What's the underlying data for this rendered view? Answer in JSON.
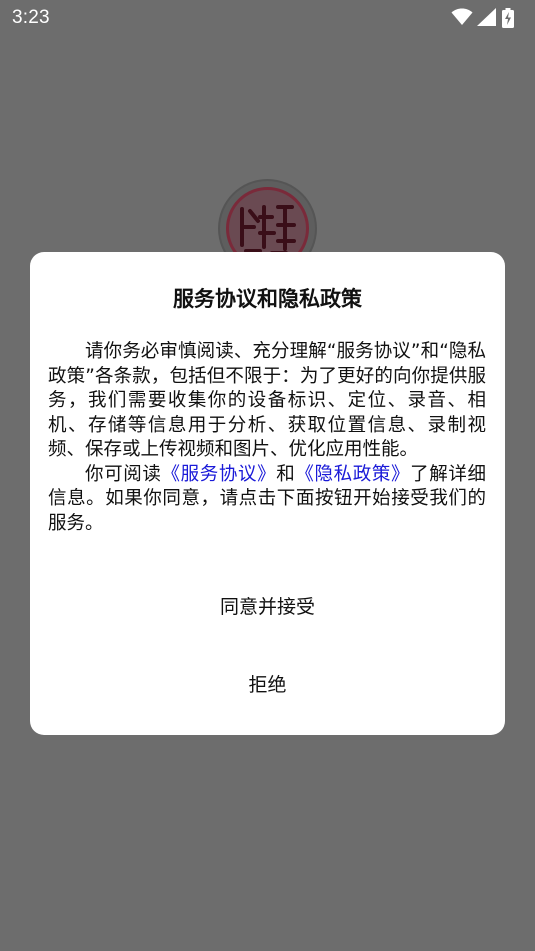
{
  "status_bar": {
    "time": "3:23",
    "icons": [
      "wifi-icon",
      "cellular-signal-icon",
      "battery-charging-icon"
    ]
  },
  "dialog": {
    "title": "服务协议和隐私政策",
    "paragraph1": "请你务必审慎阅读、充分理解“服务协议”和“隐私政策”各条款，包括但不限于：为了更好的向你提供服务，我们需要收集你的设备标识、定位、录音、相机、存储等信息用于分析、获取位置信息、录制视频、保存或上传视频和图片、优化应用性能。",
    "paragraph2_prefix": "你可阅读",
    "service_link": "《服务协议》",
    "and_text": "和",
    "privacy_link": "《隐私政策》",
    "paragraph2_suffix": "了解详细信息。如果你同意，请点击下面按钮开始接受我们的服务。",
    "agree_button": "同意并接受",
    "refuse_button": "拒绝"
  },
  "colors": {
    "overlay": "#6d6d6d",
    "dialog_bg": "#ffffff",
    "link": "#1a1ad8",
    "logo_accent": "#7a2a3a"
  }
}
